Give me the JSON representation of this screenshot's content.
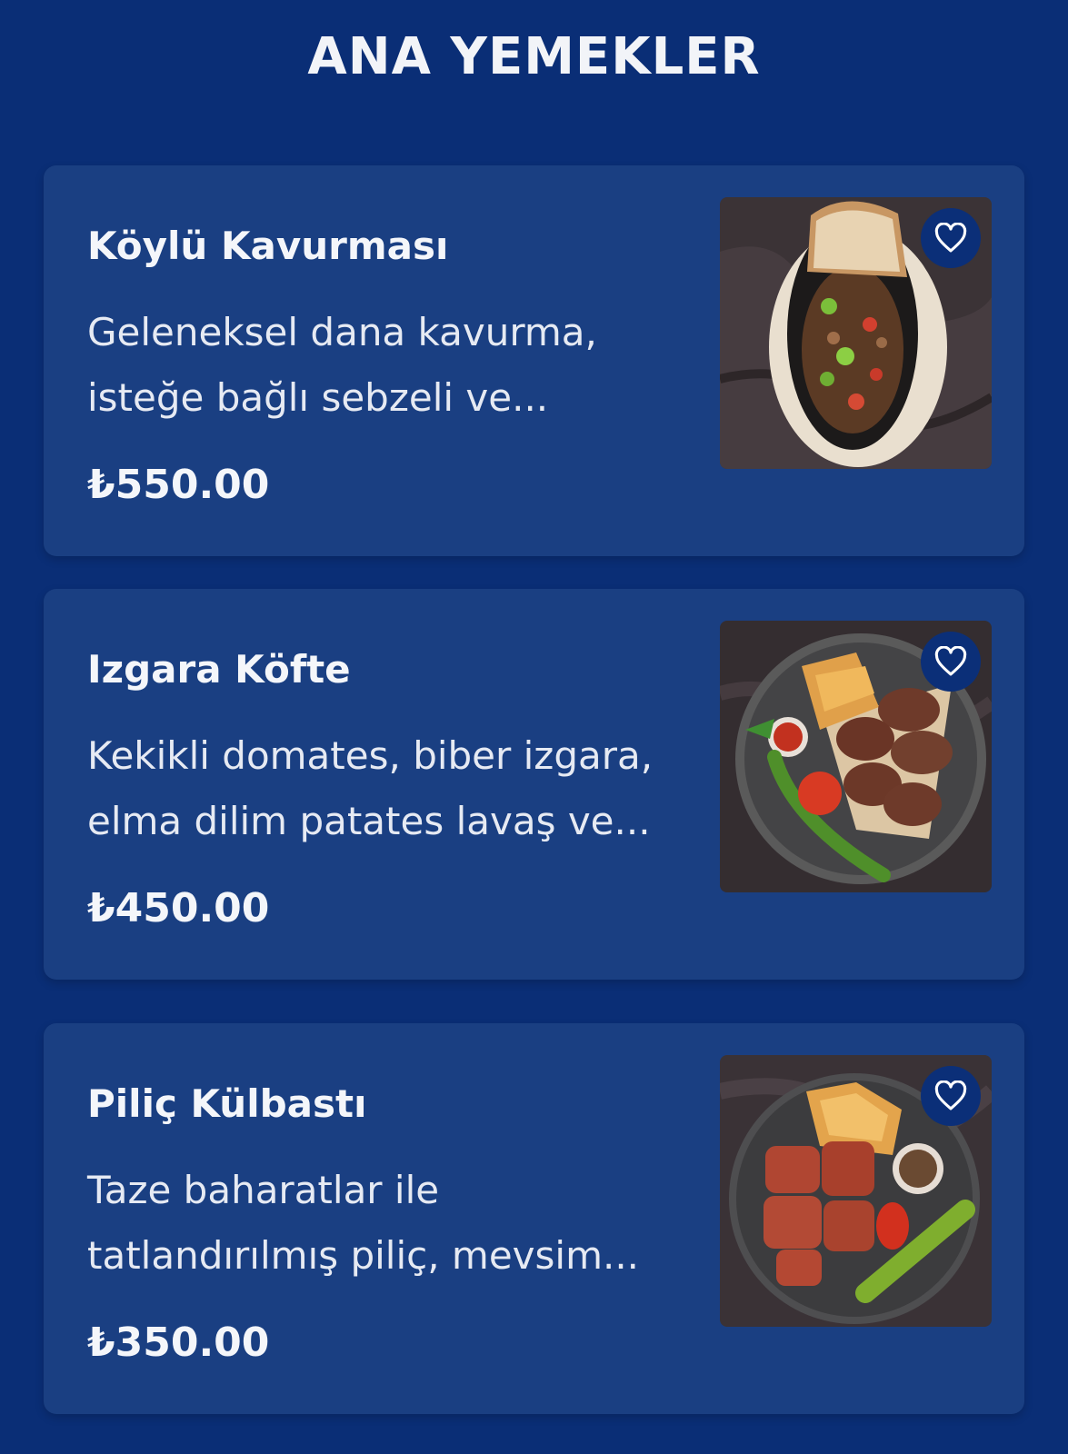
{
  "section": {
    "title": "ANA YEMEKLER"
  },
  "items": [
    {
      "name": "Köylü Kavurması",
      "description_lines": [
        "Geleneksel dana kavurma,",
        "isteğe bağlı sebzeli ve..."
      ],
      "price": "₺550.00",
      "favorite_icon": "heart-outline-icon"
    },
    {
      "name": "Izgara Köfte",
      "description_lines": [
        "Kekikli domates, biber izgara,",
        "elma dilim patates lavaş ve..."
      ],
      "price": "₺450.00",
      "favorite_icon": "heart-outline-icon"
    },
    {
      "name": "Piliç Külbastı",
      "description_lines": [
        "Taze baharatlar ile",
        "tatlandırılmış piliç, mevsim..."
      ],
      "price": "₺350.00",
      "favorite_icon": "heart-outline-icon"
    }
  ],
  "colors": {
    "background": "#0a2e76",
    "card": "#1a3f82",
    "text": "#f4f6fa",
    "favorite_button": "#0b2f78"
  }
}
